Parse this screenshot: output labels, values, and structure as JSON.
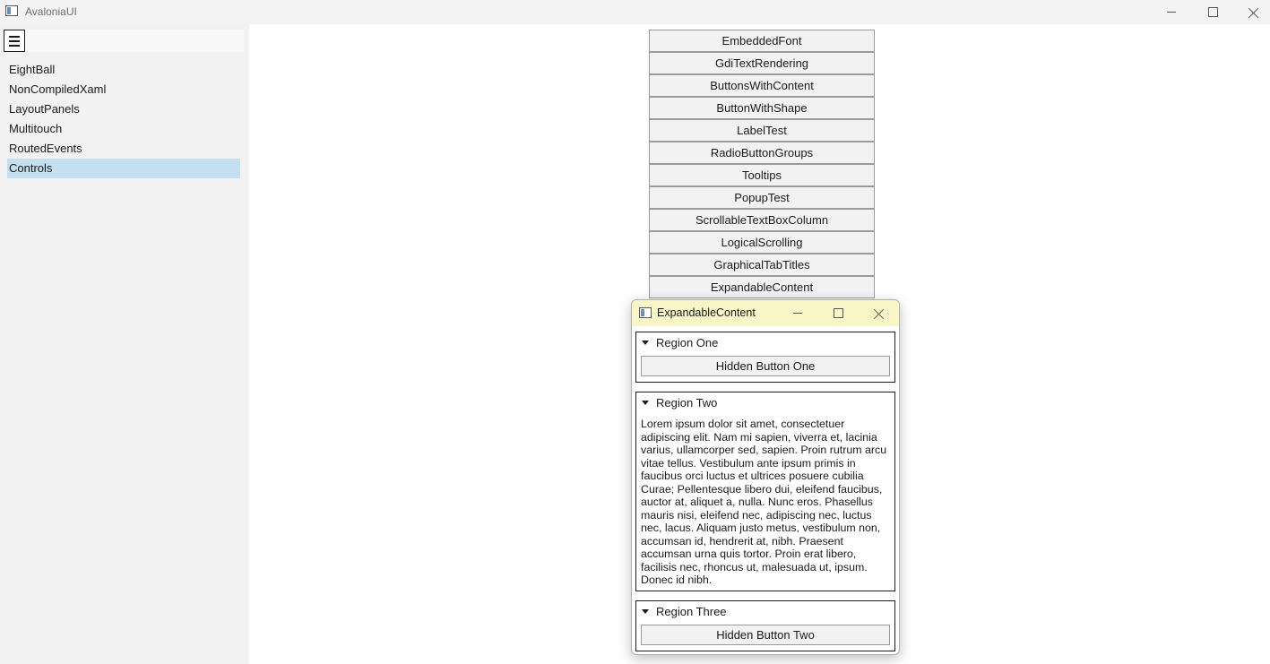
{
  "window": {
    "title": "AvaloniaUI",
    "icon": "app-window-icon"
  },
  "sidebar": {
    "menu_icon": "hamburger-icon",
    "items": [
      {
        "label": "EightBall",
        "selected": false
      },
      {
        "label": "NonCompiledXaml",
        "selected": false
      },
      {
        "label": "LayoutPanels",
        "selected": false
      },
      {
        "label": "Multitouch",
        "selected": false
      },
      {
        "label": "RoutedEvents",
        "selected": false
      },
      {
        "label": "Controls",
        "selected": true
      }
    ]
  },
  "main": {
    "buttons": [
      "EmbeddedFont",
      "GdiTextRendering",
      "ButtonsWithContent",
      "ButtonWithShape",
      "LabelTest",
      "RadioButtonGroups",
      "Tooltips",
      "PopupTest",
      "ScrollableTextBoxColumn",
      "LogicalScrolling",
      "GraphicalTabTitles",
      "ExpandableContent"
    ]
  },
  "child_window": {
    "title": "ExpandableContent",
    "title_bar_color": "#f8f5c7",
    "regions": [
      {
        "header": "Region One",
        "button": "Hidden Button One"
      },
      {
        "header": "Region Two",
        "text": "Lorem ipsum dolor sit amet, consectetuer adipiscing elit. Nam mi sapien, viverra et, lacinia varius, ullamcorper sed, sapien. Proin rutrum arcu vitae tellus. Vestibulum ante ipsum primis in faucibus orci luctus et ultrices posuere cubilia Curae; Pellentesque libero dui, eleifend faucibus, auctor at, aliquet a, nulla. Nunc eros. Phasellus mauris nisi, eleifend nec, adipiscing nec, luctus nec, lacus. Aliquam justo metus, vestibulum non, accumsan id, hendrerit at, nibh. Praesent accumsan urna quis tortor. Proin erat libero, facilisis nec, rhoncus ut, malesuada ut, ipsum. Donec id nibh."
      },
      {
        "header": "Region Three",
        "button": "Hidden Button Two"
      }
    ]
  },
  "colors": {
    "sidebar_bg": "#f2f2f2",
    "selected_item": "#c4dff0",
    "button_bg": "#f2f2f2"
  }
}
